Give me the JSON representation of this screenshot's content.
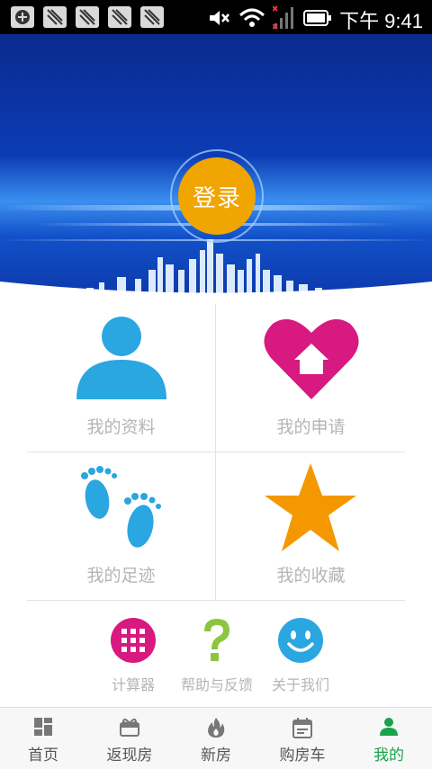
{
  "status_bar": {
    "time": "下午 9:41"
  },
  "header": {
    "login_label": "登录"
  },
  "grid_items": [
    {
      "label": "我的资料",
      "icon": "person-icon",
      "color": "#2aa6e0"
    },
    {
      "label": "我的申请",
      "icon": "heart-house-icon",
      "color": "#d8197f"
    },
    {
      "label": "我的足迹",
      "icon": "footprints-icon",
      "color": "#2aa6e0"
    },
    {
      "label": "我的收藏",
      "icon": "star-icon",
      "color": "#f39800"
    }
  ],
  "small_items": [
    {
      "label": "计算器",
      "icon": "calculator-icon",
      "color": "#d8197f"
    },
    {
      "label": "帮助与反馈",
      "icon": "question-icon",
      "color": "#8cc63f"
    },
    {
      "label": "关于我们",
      "icon": "smiley-icon",
      "color": "#2aa6e0"
    }
  ],
  "tabs": [
    {
      "label": "首页",
      "icon": "home-grid-icon"
    },
    {
      "label": "返现房",
      "icon": "gift-icon"
    },
    {
      "label": "新房",
      "icon": "flame-icon"
    },
    {
      "label": "购房车",
      "icon": "calendar-icon"
    },
    {
      "label": "我的",
      "icon": "user-icon",
      "active": true
    }
  ],
  "colors": {
    "active_tab": "#1aa34a",
    "login_button": "#f0a500",
    "hero_blue": "#0a3fb0"
  }
}
